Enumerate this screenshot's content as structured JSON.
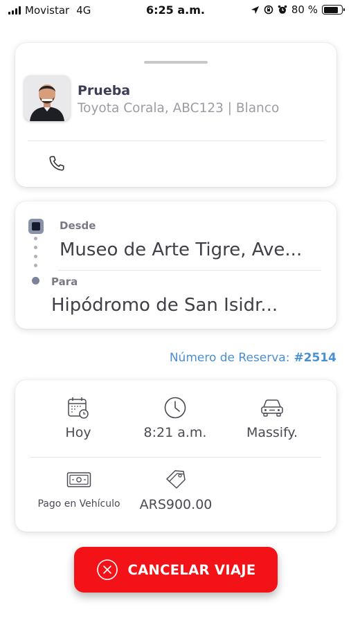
{
  "status_bar": {
    "carrier": "Movistar",
    "network": "4G",
    "time": "6:25 a.m.",
    "battery": "80 %",
    "battery_level": 0.8,
    "icons": [
      "location-arrow-icon",
      "rotation-lock-icon",
      "alarm-icon"
    ]
  },
  "driver": {
    "name": "Prueba",
    "vehicle": "Toyota Corala, ABC123 | Blanco",
    "avatar_icon": "driver-photo",
    "call_icon": "phone-icon"
  },
  "route": {
    "from_label": "Desde",
    "from_value": "Museo de Arte Tigre, Ave...",
    "to_label": "Para",
    "to_value": "Hipódromo de San Isidr..."
  },
  "reservation": {
    "label": "Número de Reserva:",
    "number": "#2514"
  },
  "details": {
    "date": "Hoy",
    "time": "8:21 a.m.",
    "vehicle_type": "Massify.",
    "payment_method": "Pago en Vehículo",
    "price": "ARS900.00"
  },
  "actions": {
    "cancel_label": "CANCELAR VIAJE"
  },
  "colors": {
    "accent_blue": "#4a8fd1",
    "cancel_red": "#f21218",
    "text_dark": "#3b3f55",
    "text_muted": "#9b9ba6"
  }
}
